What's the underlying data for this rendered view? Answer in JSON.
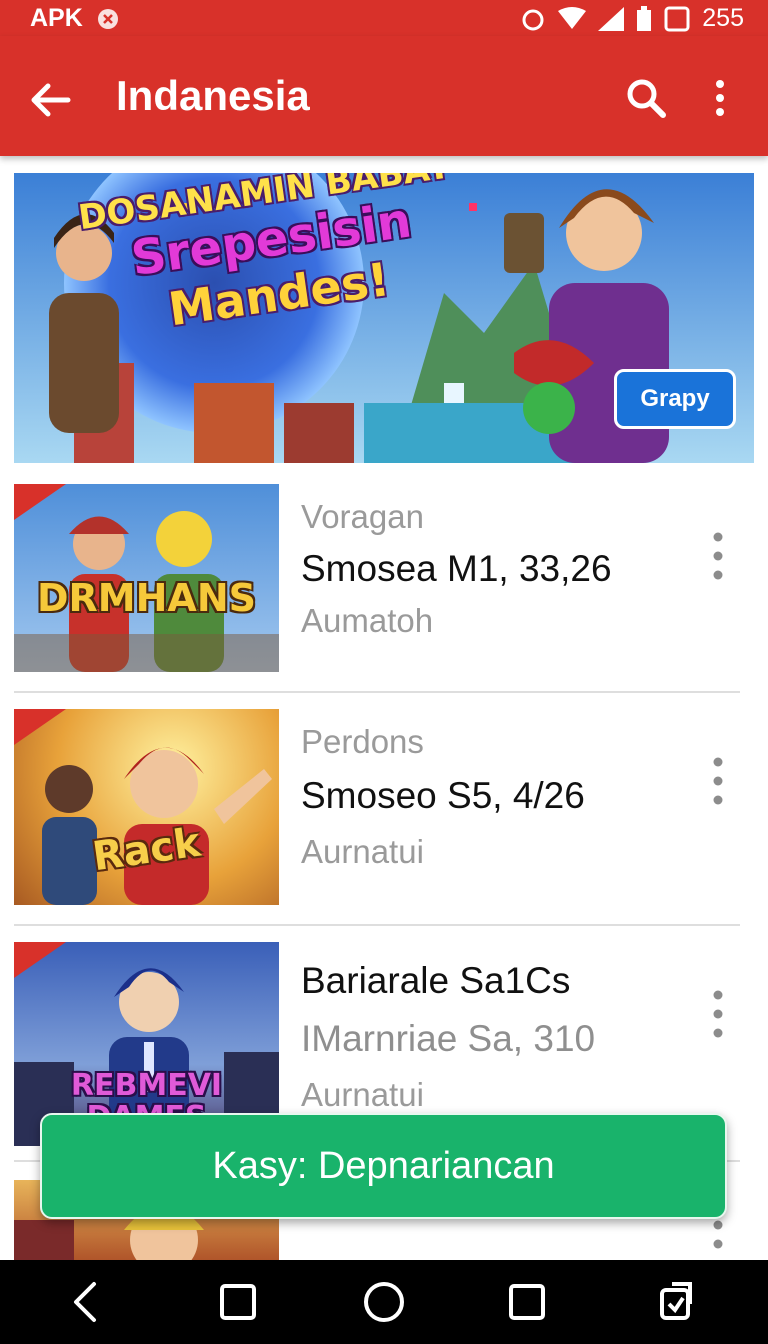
{
  "status_bar": {
    "left_text": "APK",
    "right_text": "255"
  },
  "app_bar": {
    "title": "Indanesia"
  },
  "banner": {
    "headline": [
      "DOSANAMIN BABAY",
      "Srepesisin",
      "Mandes!"
    ],
    "cta_label": "Grapy"
  },
  "items": [
    {
      "thumb_logo": "DRMHANS",
      "line1": "Voragan",
      "line2": "Smosea M1, 33,26",
      "line3": "Aumatoh"
    },
    {
      "thumb_logo": "Rack",
      "line1": "Perdons",
      "line2": "Smoseo S5, 4/26",
      "line3": "Aurnatui"
    },
    {
      "thumb_logo": "REBMEVI DAMES",
      "line1": "Bariarale Sa1Cs",
      "line2": "IMarnriae Sa, 310",
      "line3": "Aurnatui"
    }
  ],
  "snackbar": {
    "label": "Kasy: Depnariancan"
  },
  "icons": {
    "back": "arrow-left-icon",
    "search": "search-icon",
    "more": "more-vertical-icon",
    "nav": [
      "back-triangle-icon",
      "square-icon",
      "home-circle-icon",
      "recents-square-icon",
      "rotate-icon"
    ]
  },
  "colors": {
    "primary": "#d8312a",
    "snackbar": "#19b36b",
    "cta": "#1a73d9"
  }
}
